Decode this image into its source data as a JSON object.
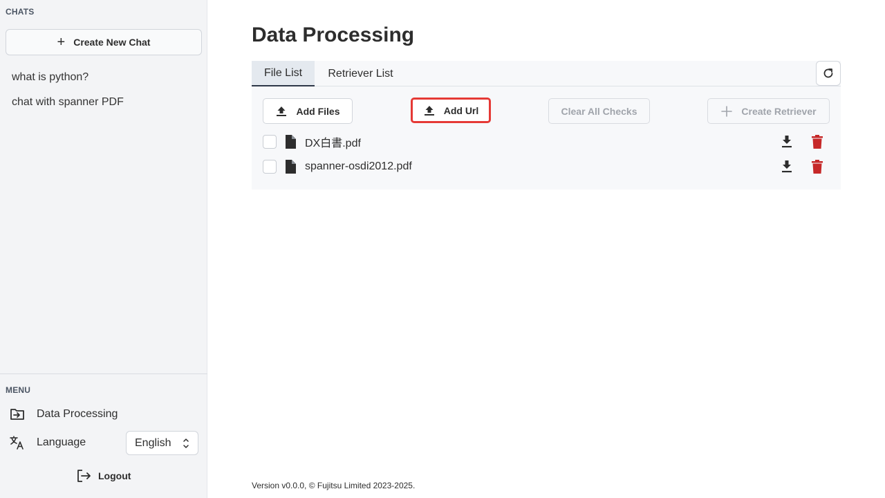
{
  "sidebar": {
    "chats_label": "CHATS",
    "new_chat_label": "Create New Chat",
    "chats": [
      "what is python?",
      "chat with spanner PDF"
    ],
    "menu_label": "MENU",
    "data_processing_label": "Data Processing",
    "language_label": "Language",
    "language_value": "English",
    "logout_label": "Logout"
  },
  "main": {
    "title": "Data Processing",
    "tabs": [
      {
        "label": "File List"
      },
      {
        "label": "Retriever List"
      }
    ],
    "toolbar": {
      "add_files": "Add Files",
      "add_url": "Add Url",
      "clear_checks": "Clear All Checks",
      "create_retriever": "Create Retriever"
    },
    "files": [
      "DX白書.pdf",
      "spanner-osdi2012.pdf"
    ],
    "footer": "Version v0.0.0, © Fujitsu Limited 2023-2025."
  },
  "colors": {
    "delete": "#c62828",
    "highlight": "#e53935"
  }
}
